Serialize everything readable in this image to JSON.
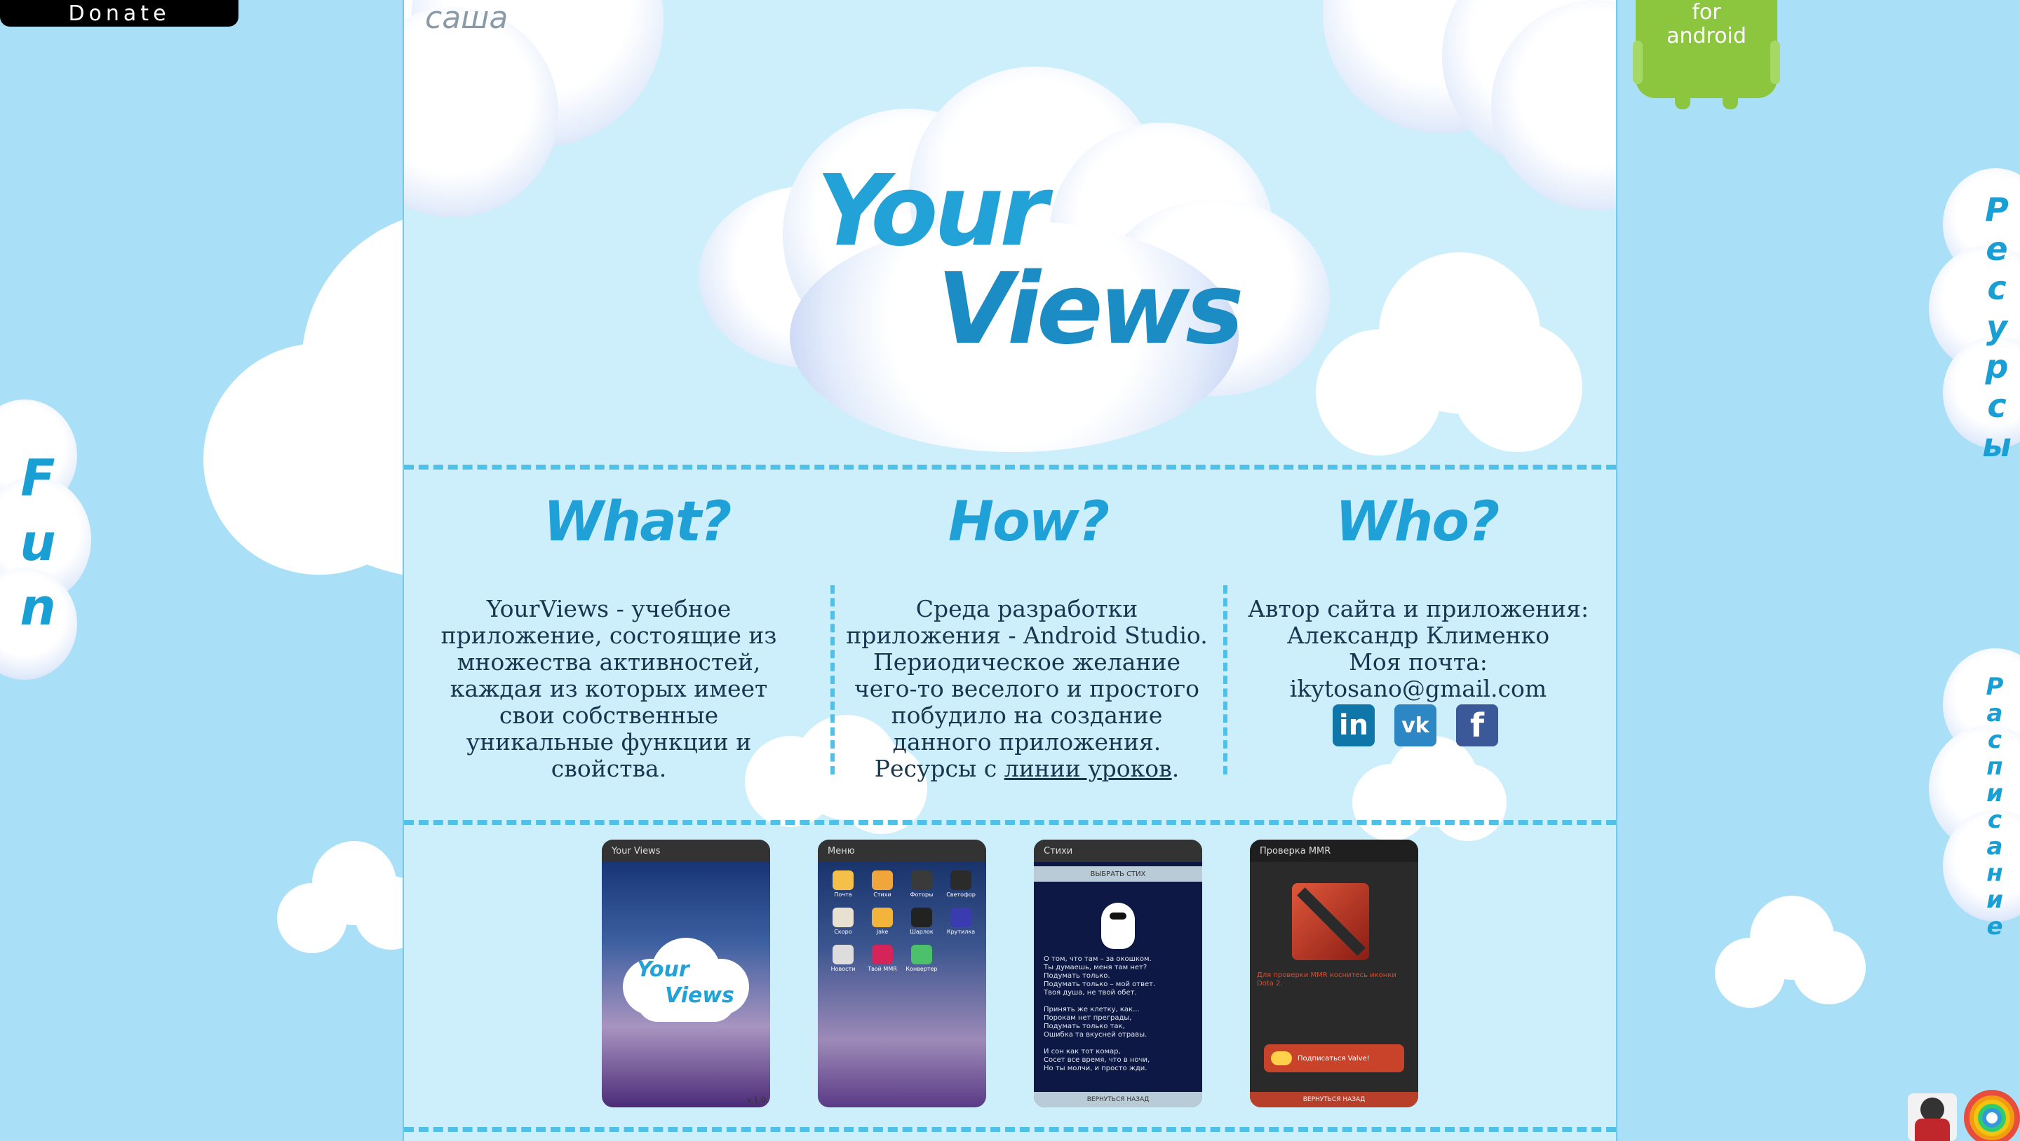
{
  "donate": {
    "label": "Donate"
  },
  "handwritten_name": "саша",
  "logo": {
    "line1": "Your",
    "line2": "Views"
  },
  "android_badge": {
    "line1": "for",
    "line2": "android"
  },
  "side_nav": {
    "left": {
      "label": "Fun"
    },
    "right_top": {
      "label": "Ресурсы"
    },
    "right_bottom": {
      "label": "Расписание"
    }
  },
  "columns": {
    "what": {
      "title": "What?",
      "text": "YourViews - учебное приложение, состоящие из множества активностей, каждая из которых имеет свои собственные уникальные функции и свойства."
    },
    "how": {
      "title": "How?",
      "text_before": "Среда разработки приложения - Android Studio. Периодическое желание чего-то веселого и простого побудило на создание данного приложения. Ресурсы с ",
      "link_text": "линии уроков",
      "text_after": "."
    },
    "who": {
      "title": "Who?",
      "line1": "Автор сайта и приложения:",
      "line2": "Александр Клименко",
      "line3": "Моя почта:",
      "line4": "ikytosano@gmail.com"
    }
  },
  "social": {
    "linkedin": {
      "label": "in",
      "color": "#0e76a8"
    },
    "vk": {
      "label": "vk",
      "color": "#2d87c4"
    },
    "facebook": {
      "label": "f",
      "color": "#3b5998"
    }
  },
  "screenshots": [
    {
      "bar_title": "Your Views",
      "logo1": "Your",
      "logo2": "Views",
      "version": "v.1.0"
    },
    {
      "bar_title": "Меню",
      "icons": [
        "Почта",
        "Стихи",
        "Фоторы",
        "Светофор",
        "Скоро",
        "Jake",
        "Шарлок",
        "Крутилка",
        "Новости",
        "Твой MMR",
        "Конвертер"
      ]
    },
    {
      "bar_title": "Стихи",
      "button_top": "ВЫБРАТЬ СТИХ",
      "poem": [
        "О том, что там – за окошком.",
        "Ты думаешь, меня там нет?",
        "Подумать только.",
        "Подумать только – мой ответ.",
        "Твоя душа, не твой обет.",
        "",
        "Принять же клетку, как...",
        "Порокам нет преграды,",
        "Подумать только так,",
        "Ошибка та вкусней отравы.",
        "",
        "И сон как тот комар,",
        "Сосет все время, что в ночи,",
        "Но ты молчи, и просто жди."
      ],
      "button_bottom": "ВЕРНУТЬСЯ НАЗАД"
    },
    {
      "bar_title": "Проверка MMR",
      "hint": "Для проверки MMR коснитесь иконки Dota 2.",
      "subscribe": "Подписаться Valve!",
      "button_bottom": "ВЕРНУТЬСЯ НАЗАД"
    }
  ]
}
